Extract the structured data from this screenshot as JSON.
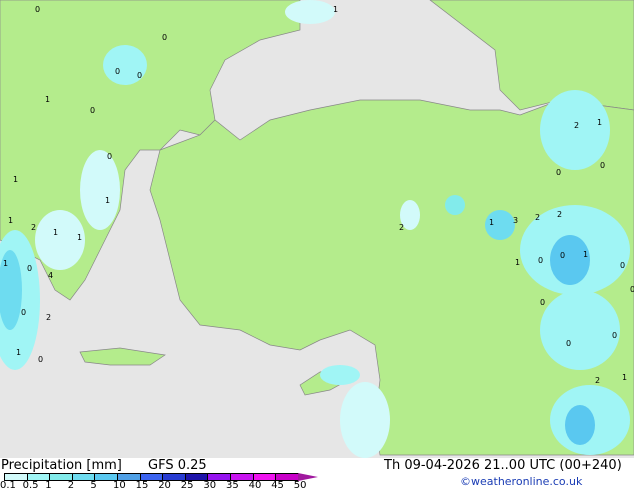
{
  "title": "Precipitation [mm]",
  "model": "GFS 0.25",
  "valid_time": "Th 09-04-2026 21..00 UTC (00+240)",
  "credit": "©weatheronline.co.uk",
  "colors": {
    "land": "#b4ec8c",
    "sea": "#e6e6e6",
    "border": "#888888"
  },
  "legend": {
    "labels": [
      "0.1",
      "0.5",
      "1",
      "2",
      "5",
      "10",
      "15",
      "20",
      "25",
      "30",
      "35",
      "40",
      "45",
      "50"
    ],
    "colors": [
      "#d2fafa",
      "#a0f5f5",
      "#82ebeb",
      "#6edcf0",
      "#5ac8f0",
      "#50a0e6",
      "#3c64f0",
      "#283cd2",
      "#1e14aa",
      "#9614f0",
      "#c814f0",
      "#f014f0",
      "#c800c8"
    ]
  },
  "point_labels": [
    "0",
    "1",
    "0",
    "0",
    "0",
    "1",
    "0",
    "0",
    "1",
    "1",
    "1",
    "2",
    "1",
    "1",
    "1",
    "0",
    "4",
    "0",
    "2",
    "1",
    "0",
    "1",
    "3",
    "2",
    "2",
    "2",
    "1",
    "0",
    "0",
    "1",
    "0",
    "0",
    "0",
    "2",
    "1",
    "0",
    "0",
    "0",
    "0",
    "2",
    "1"
  ]
}
